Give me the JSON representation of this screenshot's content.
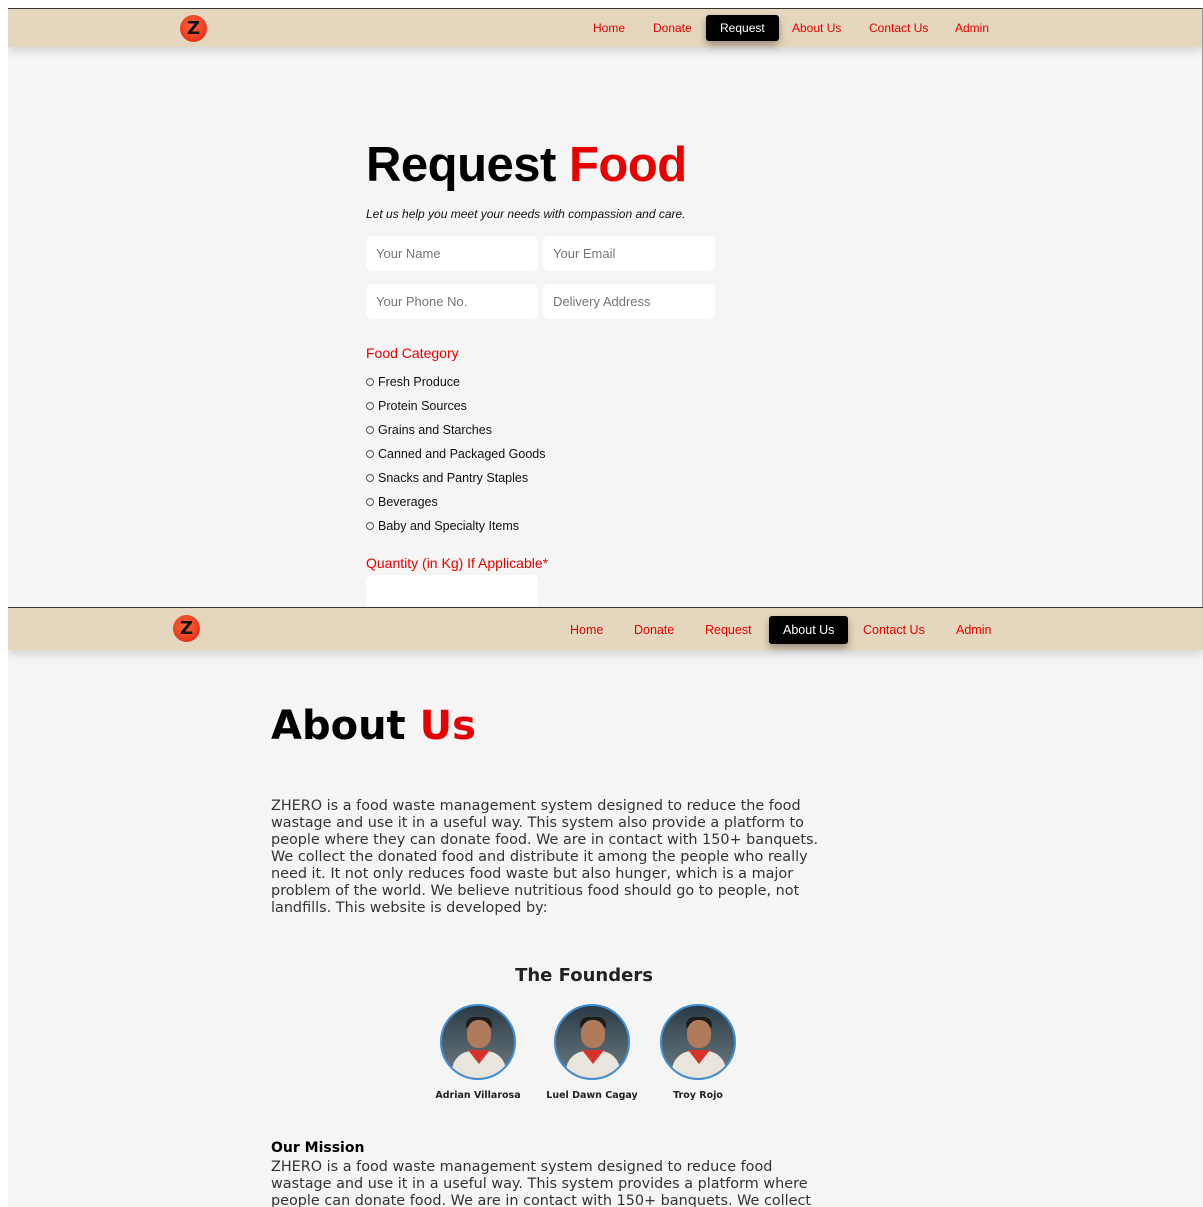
{
  "logo_letter": "Z",
  "request_page": {
    "nav": [
      "Home",
      "Donate",
      "Request",
      "About Us",
      "Contact Us",
      "Admin"
    ],
    "active_nav": "Request",
    "title_part1": "Request",
    "title_part2": "Food",
    "subtitle": "Let us help you meet your needs with compassion and care.",
    "fields": {
      "name_placeholder": "Your Name",
      "email_placeholder": "Your Email",
      "phone_placeholder": "Your Phone No.",
      "address_placeholder": "Delivery Address"
    },
    "food_category_label": "Food Category",
    "categories": [
      "Fresh Produce",
      "Protein Sources",
      "Grains and Starches",
      "Canned and Packaged Goods",
      "Snacks and Pantry Staples",
      "Beverages",
      "Baby and Specialty Items"
    ],
    "quantity_label": "Quantity (in Kg) If Applicable*"
  },
  "about_page": {
    "nav": [
      "Home",
      "Donate",
      "Request",
      "About Us",
      "Contact Us",
      "Admin"
    ],
    "active_nav": "About Us",
    "title_part1": "About",
    "title_part2": "Us",
    "intro_lines": [
      "ZHERO is a food waste management system designed to reduce the food",
      "wastage and use it in a useful way. This system also provide a platform to",
      "people where they can donate food. We are in contact with 150+ banquets.",
      "We collect the donated food and distribute it among the people who really",
      "need it. It not only reduces food waste but also hunger, which is a major",
      "problem of the world. We believe nutritious food should go to people, not",
      "landfills. This website is developed by:"
    ],
    "founders_title": "The Founders",
    "founders": [
      "Adrian Villarosa",
      "Luel Dawn Cagay",
      "Troy Rojo"
    ],
    "mission_title": "Our Mission",
    "mission_lines": [
      "ZHERO is a food waste management system designed to reduce food",
      "wastage and use it in a useful way. This system provides a platform where",
      "people can donate food. We are in contact with 150+ banquets. We collect"
    ]
  }
}
